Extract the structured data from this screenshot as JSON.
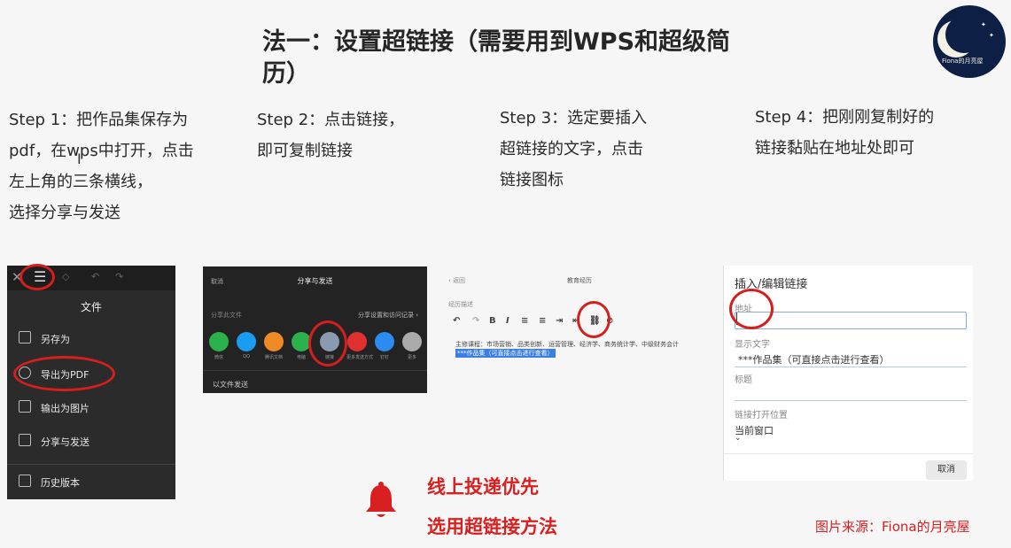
{
  "title": "法一：设置超链接（需要用到WPS和超级简历）",
  "title_lines": [
    "法一：设置超链接（需要用到WPS和超级简",
    "历）"
  ],
  "logo": {
    "text": "Fiona的月亮屋"
  },
  "steps": [
    {
      "lines": [
        "Step 1：把作品集保存为",
        "pdf，在wps中打开，点击",
        "左上角的三条横线，",
        "选择分享与发送"
      ]
    },
    {
      "lines": [
        "Step 2：点击链接，",
        "即可复制链接"
      ]
    },
    {
      "lines": [
        "Step 3：选定要插入",
        "超链接的文字，点击",
        "链接图标"
      ]
    },
    {
      "lines": [
        "Step 4：把刚刚复制好的",
        "链接黏贴在地址处即可"
      ]
    }
  ],
  "panel1": {
    "header": "文件",
    "items": [
      "另存为",
      "导出为PDF",
      "输出为图片",
      "分享与发送",
      "历史版本"
    ]
  },
  "panel2": {
    "cancel": "取消",
    "title": "分享与发送",
    "left_sub": "分享此文件",
    "right_sub": "分享设置和访问记录 ›",
    "apps": [
      {
        "name": "微信",
        "color": "#2bb24c"
      },
      {
        "name": "QQ",
        "color": "#1a9cf0"
      },
      {
        "name": "腾讯文档",
        "color": "#f08a24"
      },
      {
        "name": "电脑",
        "color": "#2bb24c"
      },
      {
        "name": "链接",
        "color": "#8a9bb1"
      },
      {
        "name": "更多发送方式",
        "color": "#e03030"
      },
      {
        "name": "钉钉",
        "color": "#2a8cf0"
      },
      {
        "name": "更多",
        "color": "#aaaaaa"
      }
    ],
    "send_file": "以文件发送"
  },
  "panel3": {
    "back": "‹ 返回",
    "section": "教育经历",
    "desc_label": "经历描述",
    "line1": "主修课程：市场营销、品类创新、运营管理、经济学、商务统计学、中级财务会计",
    "line2": "***作品集（可直接点击进行查看）"
  },
  "panel4": {
    "title": "插入/编辑链接",
    "address_label": "地址",
    "display_label": "显示文字",
    "display_value": "***作品集（可直接点击进行查看）",
    "title_label": "标题",
    "open_label": "链接打开位置",
    "open_value": "当前窗口",
    "cancel": "取消"
  },
  "notes": [
    "线上投递优先",
    "选用超链接方法"
  ],
  "credit": "图片来源：Fiona的月亮屋",
  "colors": {
    "accent_red": "#d91f1f",
    "highlight_blue": "#3a7ee6"
  }
}
